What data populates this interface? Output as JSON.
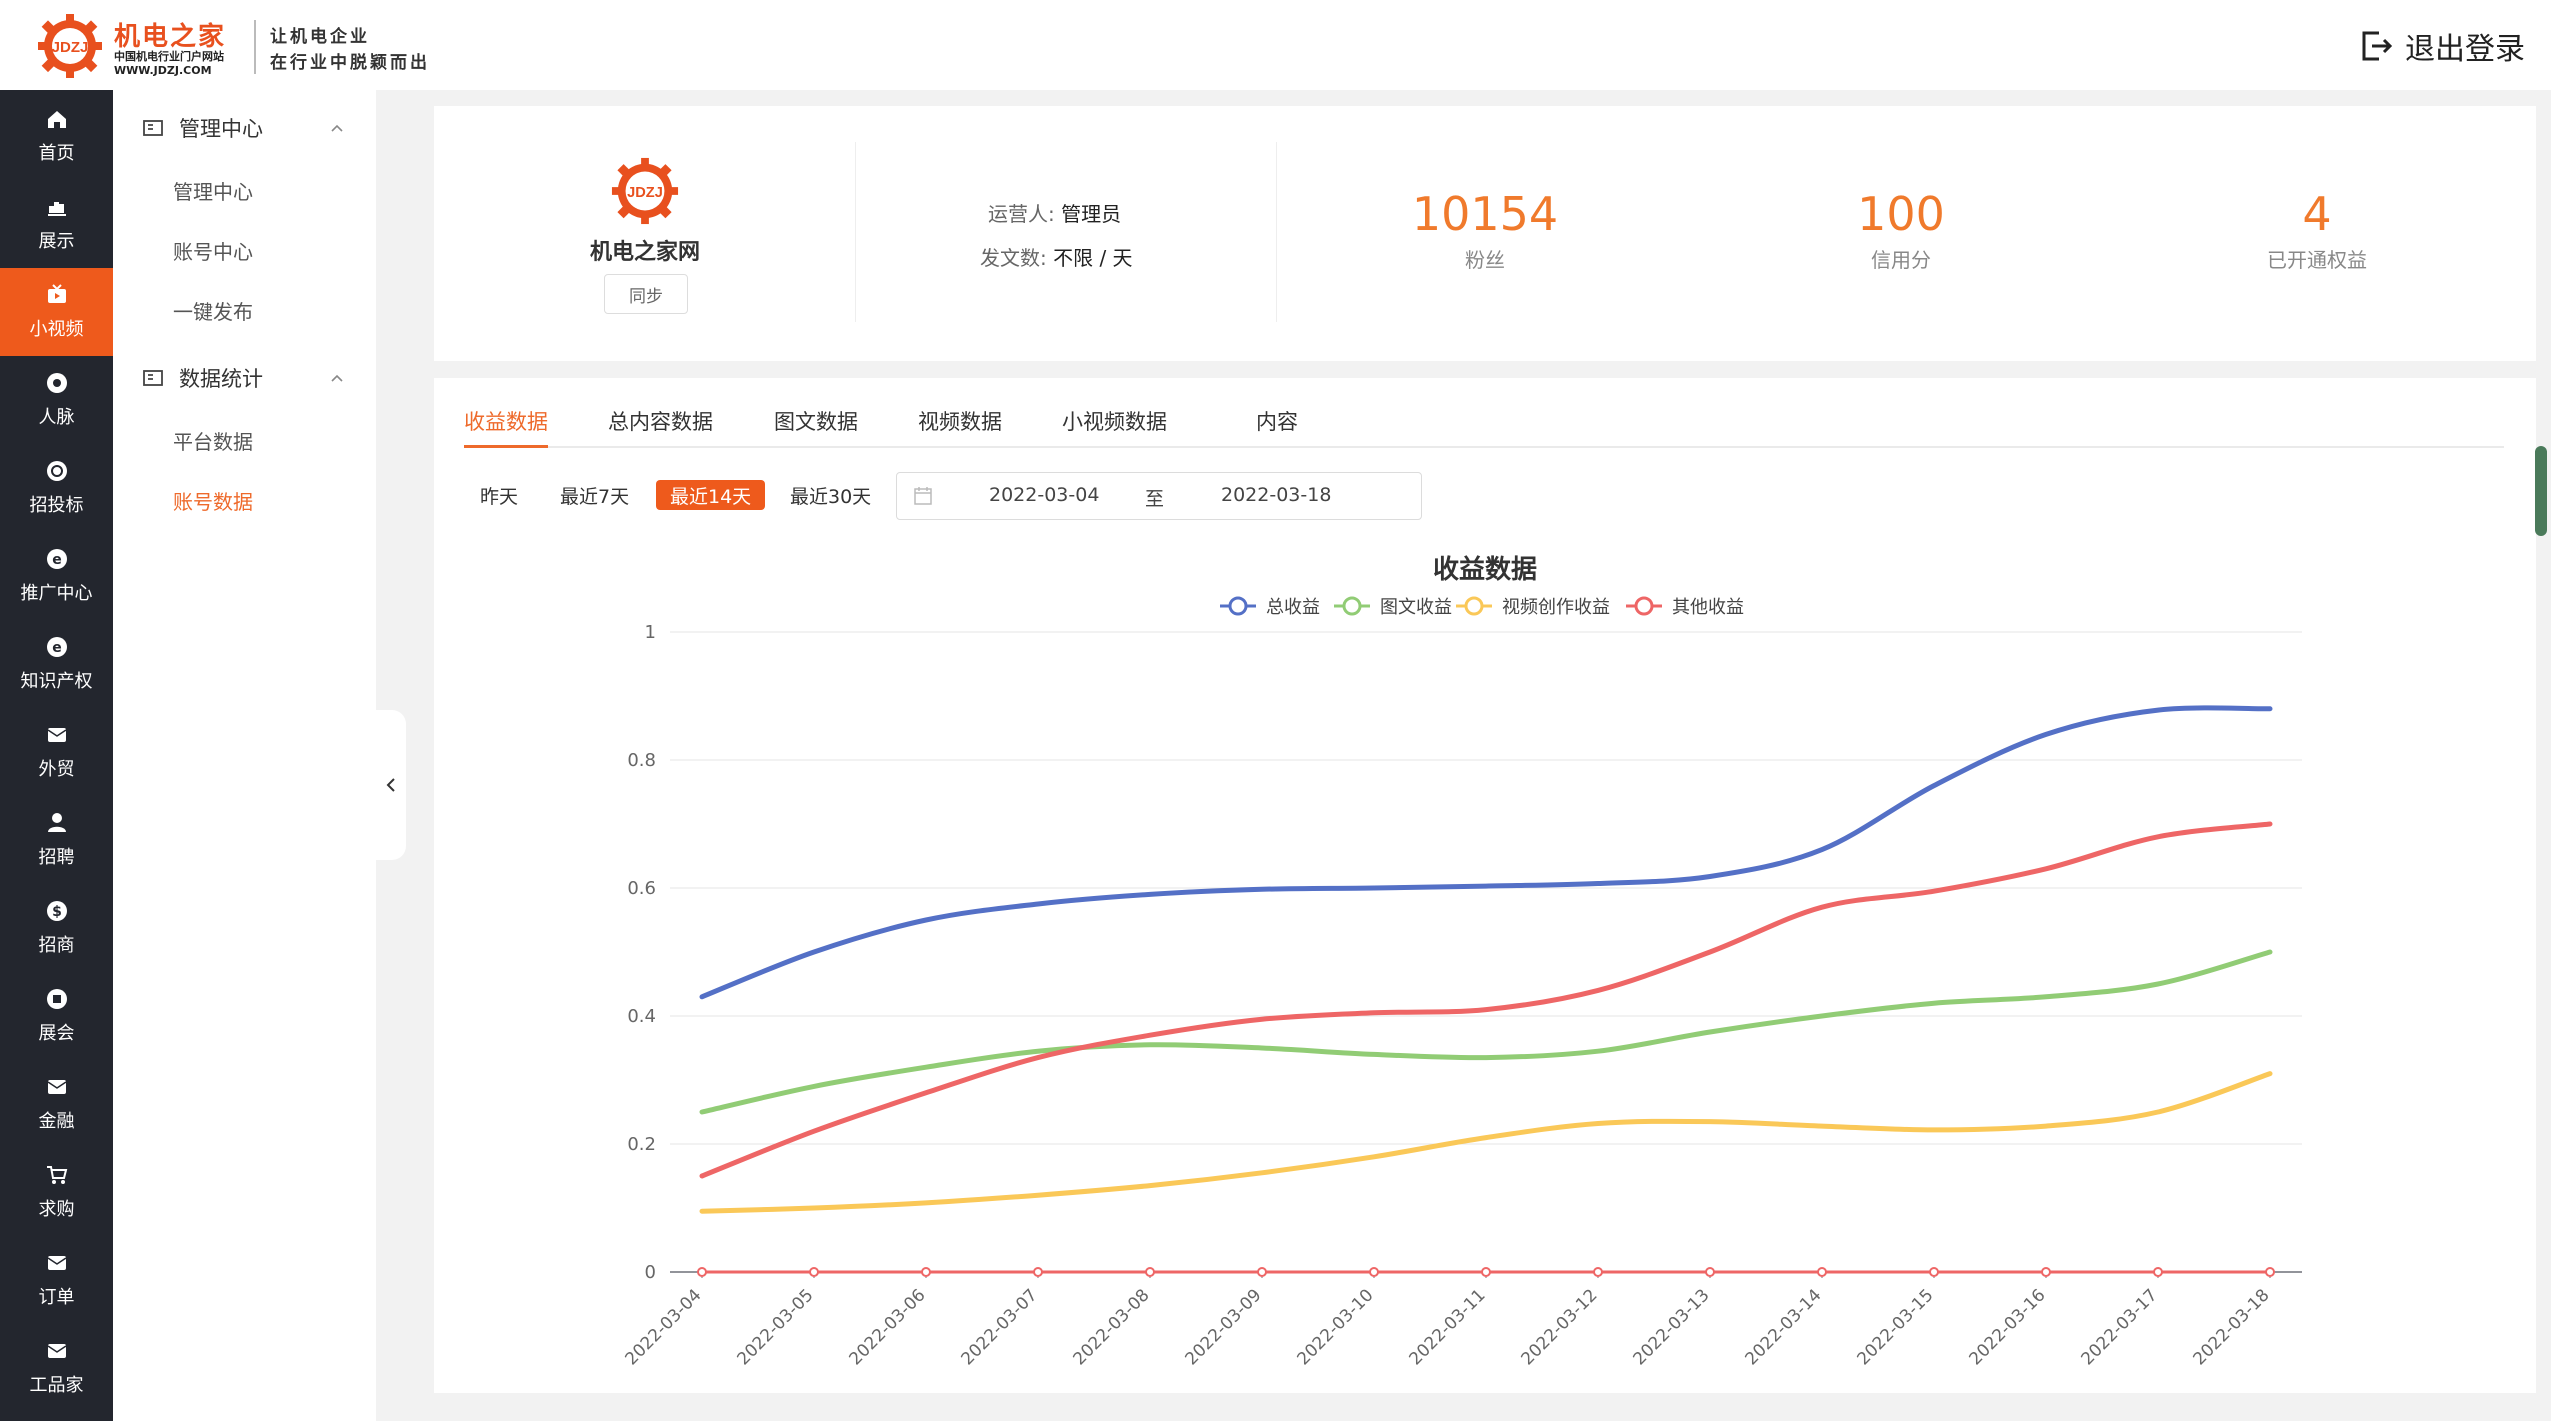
{
  "header": {
    "logo_mark": "JDZJ",
    "logo_cn": "机电之家",
    "logo_sub": "中国机电行业门户网站",
    "logo_url": "WWW.JDZJ.COM",
    "slogan_line1": "让机电企业",
    "slogan_line2": "在行业中脱颖而出",
    "logout_label": "退出登录"
  },
  "leftnav": [
    {
      "label": "首页",
      "icon": "home-icon"
    },
    {
      "label": "展示",
      "icon": "chart-icon"
    },
    {
      "label": "小视频",
      "icon": "video-icon",
      "active": true
    },
    {
      "label": "人脉",
      "icon": "network-icon"
    },
    {
      "label": "招投标",
      "icon": "bid-icon"
    },
    {
      "label": "推广中心",
      "icon": "promote-icon"
    },
    {
      "label": "知识产权",
      "icon": "ip-icon"
    },
    {
      "label": "外贸",
      "icon": "mail-icon"
    },
    {
      "label": "招聘",
      "icon": "user-icon"
    },
    {
      "label": "招商",
      "icon": "dollar-icon"
    },
    {
      "label": "展会",
      "icon": "expo-icon"
    },
    {
      "label": "金融",
      "icon": "finance-icon"
    },
    {
      "label": "求购",
      "icon": "cart-icon"
    },
    {
      "label": "订单",
      "icon": "order-icon"
    },
    {
      "label": "工品家",
      "icon": "shop-icon"
    }
  ],
  "subnav": {
    "group1": {
      "title": "管理中心",
      "items": [
        "管理中心",
        "账号中心",
        "一键发布"
      ]
    },
    "group2": {
      "title": "数据统计",
      "items": [
        "平台数据",
        "账号数据"
      ],
      "active_item": "账号数据"
    }
  },
  "account": {
    "logo_mark": "JDZJ",
    "name": "机电之家网",
    "sync_label": "同步",
    "operator_label": "运营人:",
    "operator_value": "管理员",
    "posts_label": "发文数:",
    "posts_value": "不限 / 天",
    "stats": [
      {
        "value": "10154",
        "label": "粉丝"
      },
      {
        "value": "100",
        "label": "信用分"
      },
      {
        "value": "4",
        "label": "已开通权益"
      }
    ]
  },
  "tabs": [
    "收益数据",
    "总内容数据",
    "图文数据",
    "视频数据",
    "小视频数据",
    "内容"
  ],
  "active_tab": "收益数据",
  "ranges": [
    "昨天",
    "最近7天",
    "最近14天",
    "最近30天"
  ],
  "active_range": "最近14天",
  "date_range": {
    "start": "2022-03-04",
    "separator": "至",
    "end": "2022-03-18"
  },
  "colors": {
    "accent": "#ee5a1c",
    "nav_bg": "#23262e"
  },
  "chart_data": {
    "type": "line",
    "title": "收益数据",
    "x": [
      "2022-03-04",
      "2022-03-05",
      "2022-03-06",
      "2022-03-07",
      "2022-03-08",
      "2022-03-09",
      "2022-03-10",
      "2022-03-11",
      "2022-03-12",
      "2022-03-13",
      "2022-03-14",
      "2022-03-15",
      "2022-03-16",
      "2022-03-17",
      "2022-03-18"
    ],
    "ylim": [
      0,
      1
    ],
    "yticks": [
      "0",
      "0.2",
      "0.4",
      "0.6",
      "0.8",
      "1"
    ],
    "legend_position": "top-center",
    "grid": true,
    "smooth": true,
    "series": [
      {
        "name": "总收益",
        "color": "#5470c6",
        "values": [
          0.43,
          0.5,
          0.55,
          0.575,
          0.59,
          0.598,
          0.6,
          0.603,
          0.607,
          0.618,
          0.66,
          0.76,
          0.84,
          0.878,
          0.88
        ]
      },
      {
        "name": "图文收益",
        "color": "#91cc75",
        "values": [
          0.25,
          0.29,
          0.32,
          0.345,
          0.355,
          0.35,
          0.34,
          0.335,
          0.345,
          0.375,
          0.4,
          0.42,
          0.43,
          0.45,
          0.5
        ]
      },
      {
        "name": "视频创作收益",
        "color": "#fac858",
        "values": [
          0.095,
          0.1,
          0.108,
          0.12,
          0.135,
          0.155,
          0.18,
          0.21,
          0.232,
          0.235,
          0.228,
          0.222,
          0.228,
          0.25,
          0.31
        ]
      },
      {
        "name": "其他收益",
        "color": "#ee6666",
        "values": [
          0.15,
          0.22,
          0.28,
          0.335,
          0.37,
          0.395,
          0.405,
          0.41,
          0.44,
          0.5,
          0.57,
          0.595,
          0.63,
          0.68,
          0.7
        ]
      },
      {
        "name": "",
        "color": "#ee6666",
        "values": [
          0,
          0,
          0,
          0,
          0,
          0,
          0,
          0,
          0,
          0,
          0,
          0,
          0,
          0,
          0
        ],
        "markers": true
      }
    ]
  }
}
